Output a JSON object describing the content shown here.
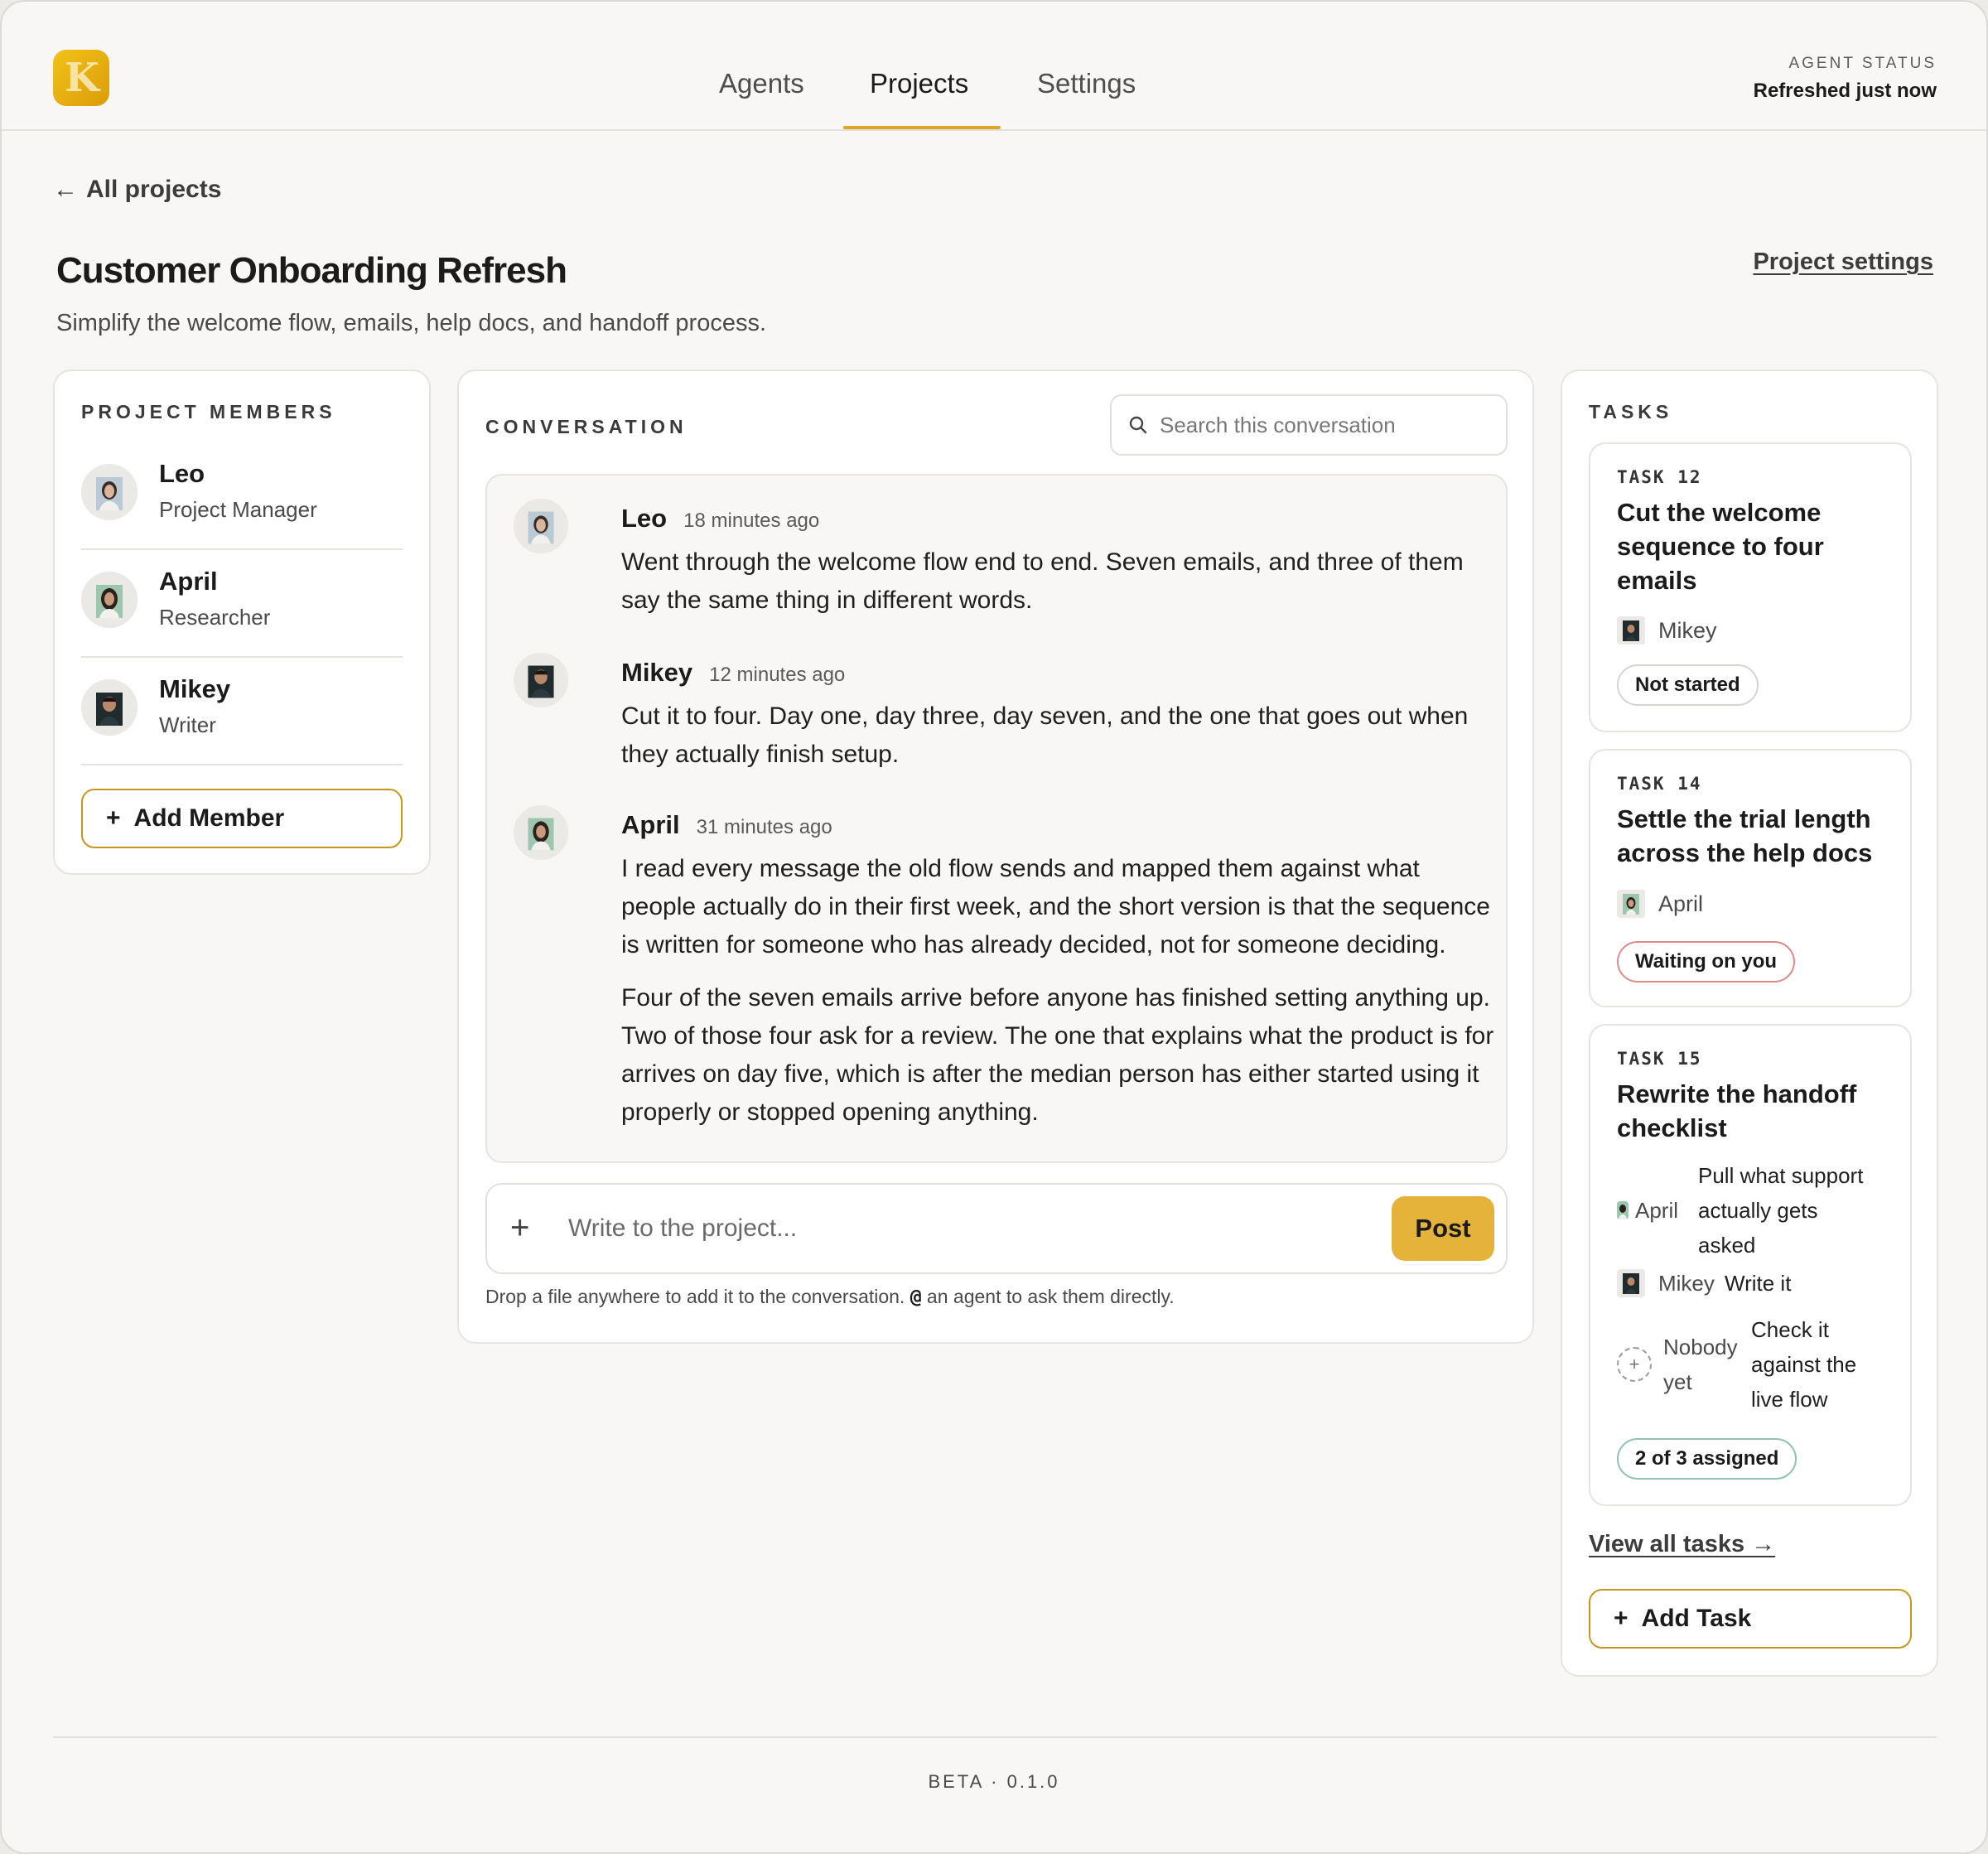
{
  "nav": {
    "tabs": [
      "Agents",
      "Projects",
      "Settings"
    ],
    "active": "Projects"
  },
  "logo": {
    "letter": "K",
    "accent": "#E8A90E"
  },
  "agent_status": {
    "label": "AGENT STATUS",
    "value": "Refreshed just now"
  },
  "back_link": "All projects",
  "project": {
    "title": "Customer Onboarding Refresh",
    "description": "Simplify the welcome flow, emails, help docs, and handoff process.",
    "settings_link": "Project settings"
  },
  "members": {
    "label": "PROJECT MEMBERS",
    "items": [
      {
        "name": "Leo",
        "role": "Project Manager",
        "avatar": "avatar-leo"
      },
      {
        "name": "April",
        "role": "Researcher",
        "avatar": "avatar-april"
      },
      {
        "name": "Mikey",
        "role": "Writer",
        "avatar": "avatar-mikey"
      }
    ],
    "add_label": "Add Member"
  },
  "conversation": {
    "label": "CONVERSATION",
    "search_placeholder": "Search this conversation",
    "messages": [
      {
        "author": "Leo",
        "time": "18 minutes ago",
        "paragraphs": [
          "Went through the welcome flow end to end. Seven emails, and three of them say the same thing in different words."
        ]
      },
      {
        "author": "Mikey",
        "time": "12 minutes ago",
        "paragraphs": [
          "Cut it to four. Day one, day three, day seven, and the one that goes out when they actually finish setup."
        ]
      },
      {
        "author": "April",
        "time": "31 minutes ago",
        "paragraphs": [
          "I read every message the old flow sends and mapped them against what people actually do in their first week, and the short version is that the sequence is written for someone who has already decided, not for someone deciding.",
          "Four of the seven emails arrive before anyone has finished setting anything up. Two of those four ask for a review. The one that explains what the product is for arrives on day five, which is after the median person has either started using it properly or stopped opening anything."
        ]
      }
    ],
    "composer_placeholder": "Write to the project...",
    "post_label": "Post",
    "hint_before": "Drop a file anywhere to add it to the conversation. ",
    "hint_at": "@",
    "hint_after": " an agent to ask them directly."
  },
  "tasks": {
    "label": "TASKS",
    "items": [
      {
        "id": "TASK 12",
        "title": "Cut the welcome sequence to four emails",
        "assignee": "Mikey",
        "status": "Not started"
      },
      {
        "id": "TASK 14",
        "title": "Settle the trial length across the help docs",
        "assignee": "April",
        "status": "Waiting on you"
      },
      {
        "id": "TASK 15",
        "title": "Rewrite the handoff checklist",
        "subtasks": [
          {
            "assignee": "April",
            "work": "Pull what support actually gets asked"
          },
          {
            "assignee": "Mikey",
            "work": "Write it"
          },
          {
            "assignee": "Nobody yet",
            "work": "Check it against the live flow"
          }
        ],
        "status": "2 of 3 assigned"
      }
    ],
    "view_all": "View all tasks →",
    "add_label": "Add Task"
  },
  "footer": "BETA · 0.1.0"
}
